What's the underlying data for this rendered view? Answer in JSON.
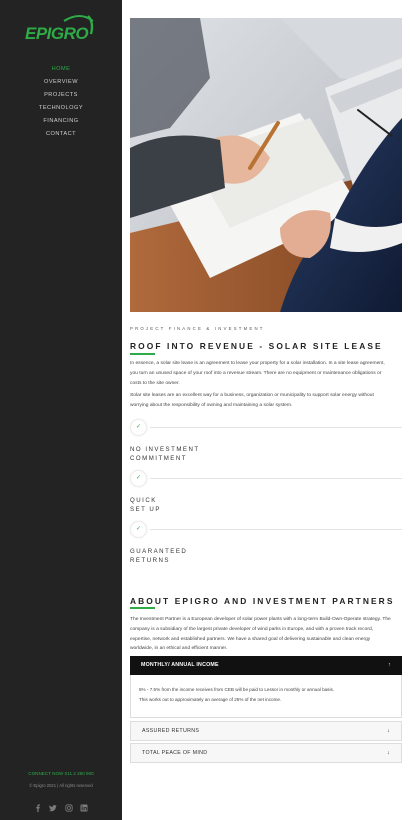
{
  "brand": {
    "name": "EPIGRO",
    "color": "#2eaa47"
  },
  "nav": [
    {
      "label": "HOME",
      "active": true
    },
    {
      "label": "OVERVIEW",
      "active": false
    },
    {
      "label": "PROJECTS",
      "active": false
    },
    {
      "label": "TECHNOLOGY",
      "active": false
    },
    {
      "label": "FINANCING",
      "active": false
    },
    {
      "label": "CONTACT",
      "active": false
    }
  ],
  "footer": {
    "connect": "CONNECT NOW 011 2 280 900",
    "copyright": "© Epigro 2021 | All rights reserved",
    "social": [
      "facebook-icon",
      "twitter-icon",
      "instagram-icon",
      "linkedin-icon"
    ]
  },
  "hero": {
    "image": "business-meeting-photo"
  },
  "section1": {
    "eyebrow": "PROJECT FINANCE & INVESTMENT",
    "title": "ROOF INTO REVENUE - SOLAR SITE LEASE",
    "paragraphs": [
      "In essence, a solar site lease is an agreement to lease your property for a solar installation. In a site lease agreement, you turn an unused space of your roof into a revenue stream. There are no equipment or maintenance obligations or costs to the site owner.",
      "Solar site leases are an excellent way for a business, organization or municipality to support solar energy without worrying about the responsibility of owning and maintaining a solar system."
    ]
  },
  "features": [
    {
      "title": "NO INVESTMENT\nCOMMITMENT",
      "icon": "check-icon"
    },
    {
      "title": "QUICK\nSET UP",
      "icon": "check-icon"
    },
    {
      "title": "GUARANTEED\nRETURNS",
      "icon": "check-icon"
    }
  ],
  "section2": {
    "title": "ABOUT EPIGRO AND INVESTMENT PARTNERS",
    "paragraph": "The Investment Partner is a European developer of solar power plants with a long-term Build-Own-Operate strategy. The company is a subsidiary of the largest private developer of wind parks in Europe, and with a proven track record, expertise, network and established partners. We have a shared goal of delivering sustainable and clean energy worldwide, in an ethical and efficient manner."
  },
  "accordion": {
    "active": {
      "title": "MONTHLY/ ANNUAL INCOME",
      "arrow": "↑",
      "lines": [
        "5% - 7.5% from the income receives from CEB will be paid to Lessor in monthly or annual basis.",
        "This works out to approximately an average of 25% of the net income."
      ]
    },
    "items": [
      {
        "title": "ASSURED RETURNS",
        "arrow": "↓"
      },
      {
        "title": "TOTAL PEACE OF MIND",
        "arrow": "↓"
      }
    ]
  }
}
